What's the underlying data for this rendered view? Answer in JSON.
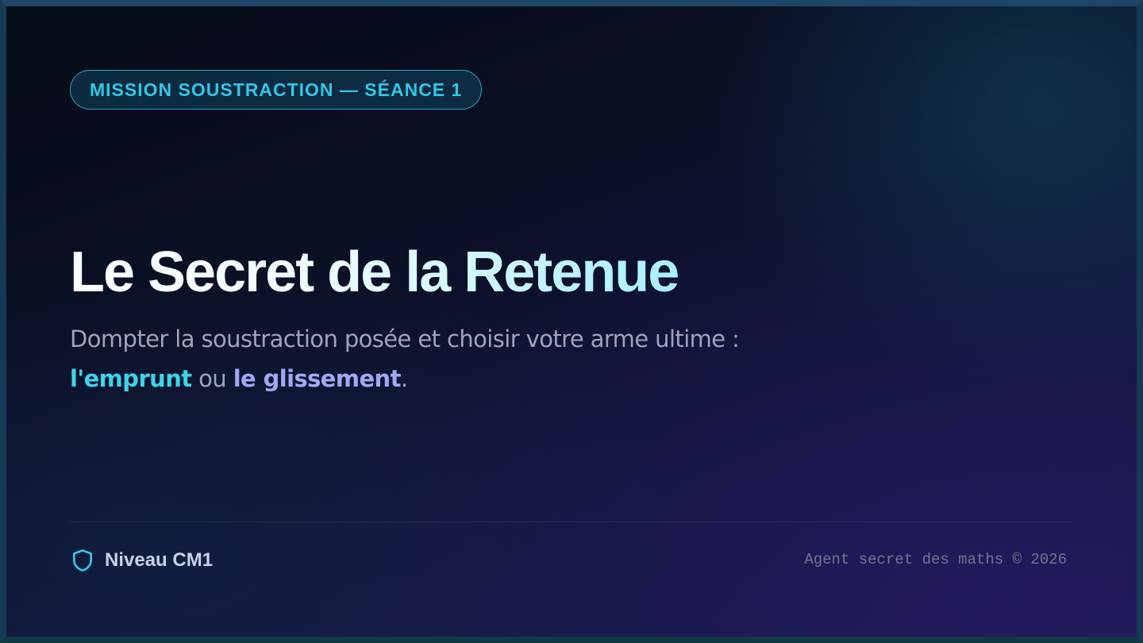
{
  "badge": {
    "label": "MISSION SOUSTRACTION — SÉANCE 1"
  },
  "hero": {
    "title": "Le Secret de la Retenue",
    "subtitle_line1": "Dompter la soustraction posée et choisir votre arme ultime :",
    "method_borrow": "l'emprunt",
    "connector": " ou ",
    "method_slide": "le glissement",
    "end_punct": "."
  },
  "footer": {
    "level_icon": "shield-icon",
    "level_label": "Niveau CM1",
    "copyright": "Agent secret des maths © 2026"
  },
  "colors": {
    "accent_cyan": "#3fd3ea",
    "accent_violet": "#a3a8f2",
    "badge_border": "#2aa6c6"
  }
}
